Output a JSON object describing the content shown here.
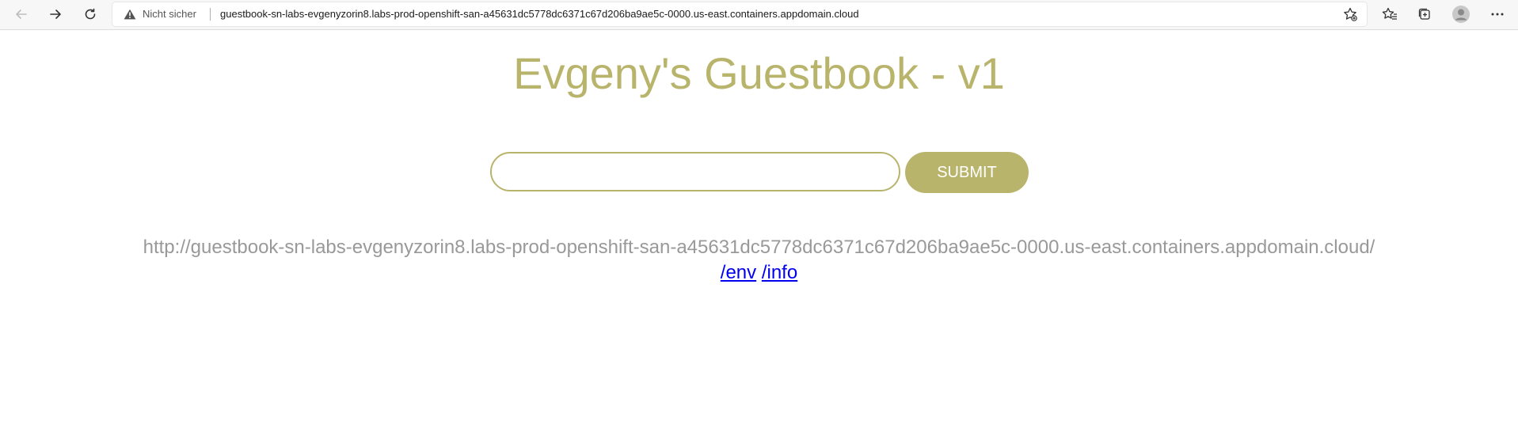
{
  "browser": {
    "security_label": "Nicht sicher",
    "url": "guestbook-sn-labs-evgenyzorin8.labs-prod-openshift-san-a45631dc5778dc6371c67d206ba9ae5c-0000.us-east.containers.appdomain.cloud",
    "icons": {
      "back": "back-arrow-icon",
      "forward": "forward-arrow-icon",
      "reload": "reload-icon",
      "warning": "warning-triangle-icon",
      "add_favorite": "add-favorite-star-icon",
      "favorites": "favorites-icon",
      "collections": "collections-icon",
      "profile": "profile-avatar-icon",
      "menu": "more-menu-icon"
    }
  },
  "page": {
    "title": "Evgeny's Guestbook - v1",
    "entry_input": {
      "value": "",
      "placeholder": ""
    },
    "submit_label": "SUBMIT",
    "host_url": "http://guestbook-sn-labs-evgenyzorin8.labs-prod-openshift-san-a45631dc5778dc6371c67d206ba9ae5c-0000.us-east.containers.appdomain.cloud/",
    "links": [
      {
        "label": "/env"
      },
      {
        "label": "/info"
      }
    ]
  },
  "colors": {
    "accent": "#b9b46b",
    "url_text": "#999999",
    "link": "#0000ee"
  }
}
